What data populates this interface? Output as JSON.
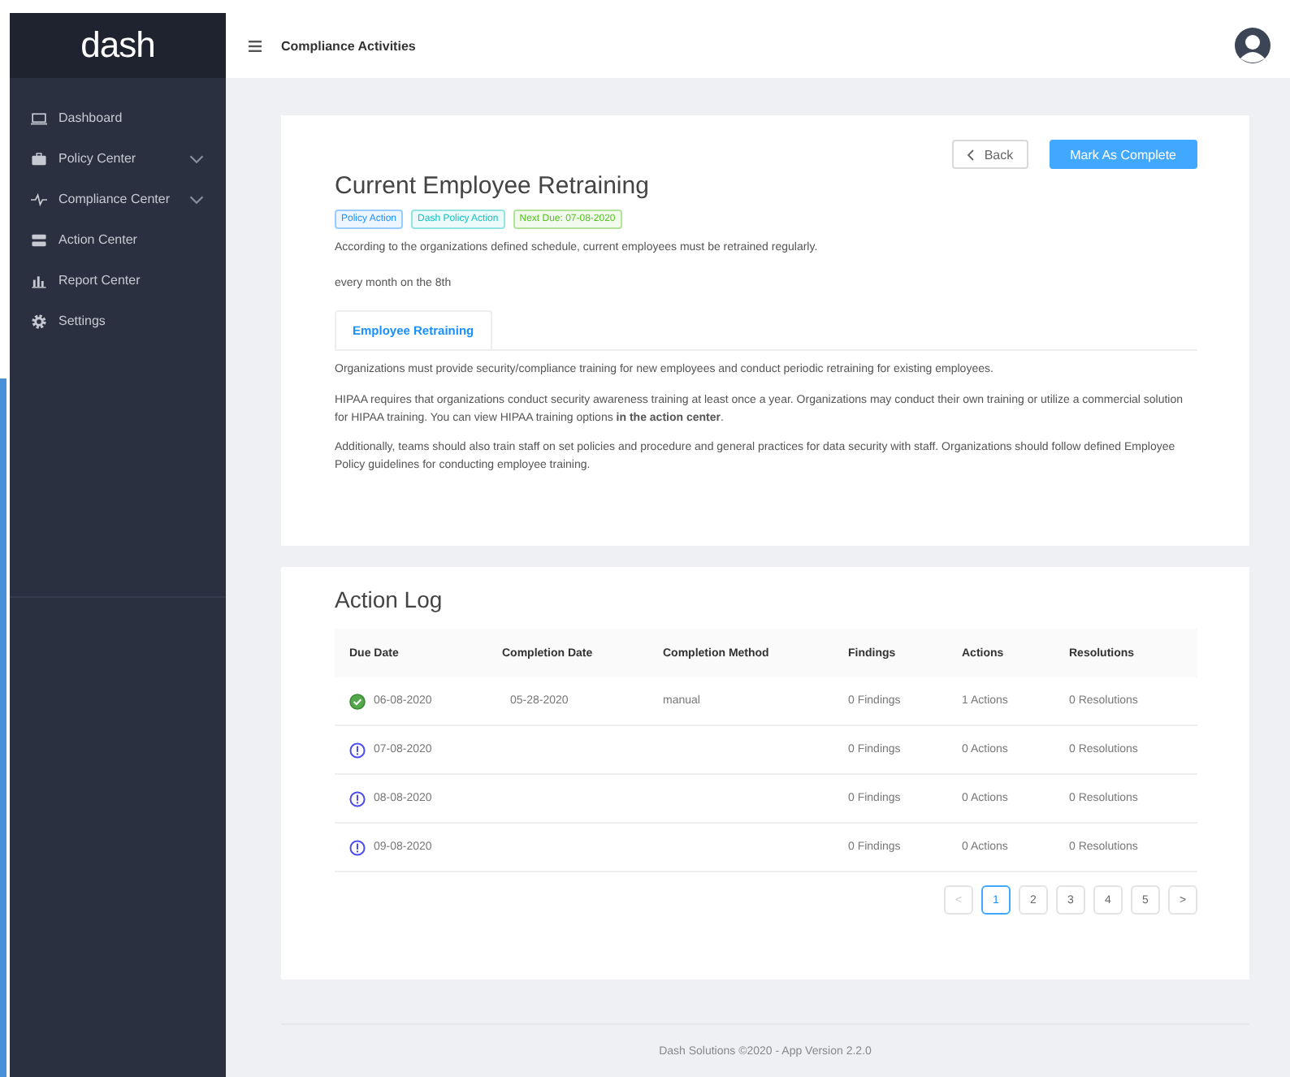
{
  "sidebar": {
    "logo": "dash",
    "items": [
      {
        "label": "Dashboard",
        "kind": "link"
      },
      {
        "label": "Policy Center",
        "kind": "group",
        "expanded": false
      },
      {
        "label": "Compliance Center",
        "kind": "group",
        "expanded": false
      },
      {
        "label": "Action Center",
        "kind": "link"
      },
      {
        "label": "Report Center",
        "kind": "link"
      },
      {
        "label": "Settings",
        "kind": "link"
      }
    ]
  },
  "header": {
    "title": "Compliance Activities"
  },
  "activity": {
    "back_button": "Back",
    "complete_button": "Mark As Complete",
    "title": "Current Employee Retraining",
    "tags": [
      {
        "label": "Policy Action",
        "color": "#1890ff"
      },
      {
        "label": "Dash Policy Action",
        "color": "#13c2c2"
      },
      {
        "label": "Next Due: 07-08-2020",
        "color": "#52c41a"
      }
    ],
    "description": "According to the organizations defined schedule, current employees must be retrained regularly.",
    "schedule": "every month on the 8th",
    "tabs": [
      {
        "label": "Employee Retraining",
        "selected": true
      }
    ],
    "paragraphs": [
      "Organizations must provide security/compliance training for new employees and conduct periodic retraining for existing employees.",
      "HIPAA requires that organizations conduct security awareness training at least once a year. Organizations may conduct their own training or utilize a commercial solution for HIPAA training. You can view HIPAA training options **in the action center**.",
      "Additionally, teams should also train staff on set policies and procedure and general practices for data security with staff. Organizations should follow defined Employee Policy guidelines for conducting employee training."
    ]
  },
  "action_log": {
    "title": "Action Log",
    "columns": [
      "Due Date",
      "Completion Date",
      "Completion Method",
      "Findings",
      "Actions",
      "Resolutions"
    ],
    "rows": [
      {
        "completed": true,
        "due_date": "06-08-2020",
        "completion_date": "05-28-2020",
        "completion_method": "manual",
        "findings": "0 Findings",
        "actions": "1 Actions",
        "resolutions": "0 Resolutions"
      },
      {
        "completed": false,
        "due_date": "07-08-2020",
        "findings": "0 Findings",
        "actions": "0 Actions",
        "resolutions": "0 Resolutions"
      },
      {
        "completed": false,
        "due_date": "08-08-2020",
        "findings": "0 Findings",
        "actions": "0 Actions",
        "resolutions": "0 Resolutions"
      },
      {
        "completed": false,
        "due_date": "09-08-2020",
        "findings": "0 Findings",
        "actions": "0 Actions",
        "resolutions": "0 Resolutions"
      }
    ],
    "pagination": {
      "prev": "<",
      "next": ">",
      "pages": [
        {
          "label": "1",
          "selected": true
        },
        {
          "label": "2",
          "selected": false
        },
        {
          "label": "3",
          "selected": false
        },
        {
          "label": "4",
          "selected": false
        },
        {
          "label": "5",
          "selected": false
        }
      ]
    }
  },
  "footer": "Dash Solutions ©2020 - App Version 2.2.0"
}
